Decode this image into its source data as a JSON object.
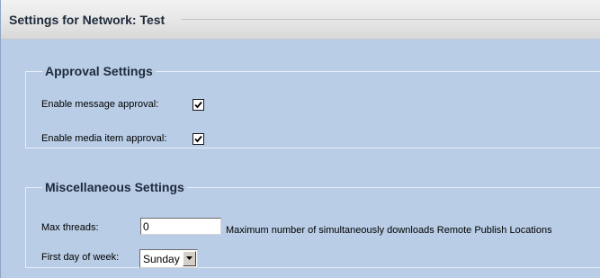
{
  "header": {
    "title": "Settings for Network: Test"
  },
  "approval": {
    "legend": "Approval Settings",
    "message_approval": {
      "label": "Enable message approval:",
      "checked": true
    },
    "media_approval": {
      "label": "Enable media item approval:",
      "checked": true
    }
  },
  "misc": {
    "legend": "Miscellaneous Settings",
    "max_threads": {
      "label": "Max threads:",
      "value": "0",
      "hint": "Maximum number of simultaneously downloads Remote Publish Locations"
    },
    "first_day": {
      "label": "First day of week:",
      "selected": "Sunday"
    }
  },
  "colors": {
    "panel_background": "#b9cde6",
    "header_background": "#e6e6e6",
    "text": "#1e2a3a"
  }
}
